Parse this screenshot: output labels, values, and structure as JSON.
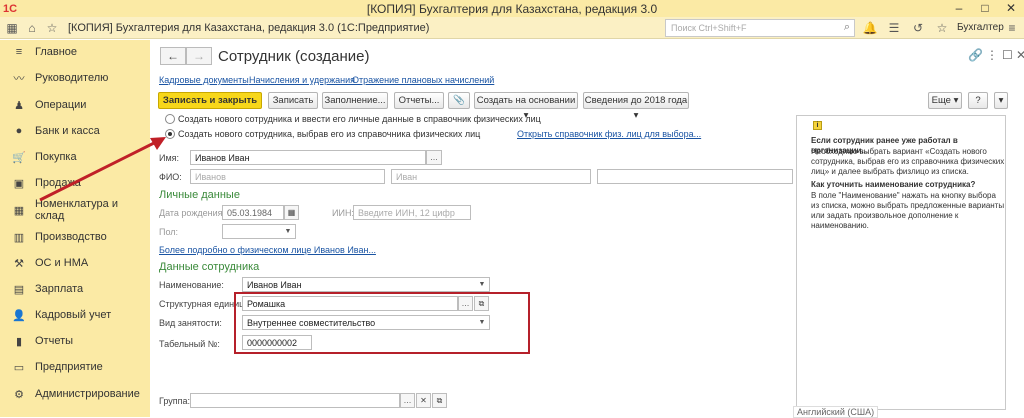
{
  "app": {
    "logo": "1С",
    "title": "[КОПИЯ] Бухгалтерия для Казахстана, редакция 3.0",
    "subtitle": "[КОПИЯ] Бухгалтерия для Казахстана, редакция 3.0  (1С:Предприятие)",
    "search_placeholder": "Поиск Ctrl+Shift+F",
    "user": "Бухгалтер"
  },
  "sidebar": {
    "items": [
      {
        "label": "Главное",
        "icon": "menu-icon"
      },
      {
        "label": "Руководителю",
        "icon": "chart-icon"
      },
      {
        "label": "Операции",
        "icon": "operations-icon"
      },
      {
        "label": "Банк и касса",
        "icon": "bank-icon"
      },
      {
        "label": "Покупка",
        "icon": "cart-icon"
      },
      {
        "label": "Продажа",
        "icon": "bag-icon"
      },
      {
        "label": "Номенклатура и склад",
        "icon": "warehouse-icon"
      },
      {
        "label": "Производство",
        "icon": "production-icon"
      },
      {
        "label": "ОС и НМА",
        "icon": "assets-icon"
      },
      {
        "label": "Зарплата",
        "icon": "salary-icon"
      },
      {
        "label": "Кадровый учет",
        "icon": "personnel-icon"
      },
      {
        "label": "Отчеты",
        "icon": "reports-icon"
      },
      {
        "label": "Предприятие",
        "icon": "enterprise-icon"
      },
      {
        "label": "Администрирование",
        "icon": "admin-icon"
      }
    ]
  },
  "form": {
    "title": "Сотрудник (создание)",
    "links": [
      "Кадровые документы",
      "Начисления и удержания",
      "Отражение плановых начислений"
    ],
    "buttons": {
      "save_close": "Записать и закрыть",
      "save": "Записать",
      "fill": "Заполнение...",
      "reports": "Отчеты...",
      "create_based": "Создать на основании",
      "info2018": "Сведения до 2018 года",
      "more": "Еще",
      "help": "?"
    },
    "radio1": "Создать нового сотрудника и ввести его личные данные в справочник физических лиц",
    "radio2": "Создать нового сотрудника, выбрав его из справочника физических лиц",
    "open_ref_link": "Открыть справочник физ. лиц для выбора...",
    "name_label": "Имя:",
    "name_value": "Иванов Иван",
    "fio_label": "ФИО:",
    "fio_placeholder1": "Иванов",
    "fio_placeholder2": "Иван",
    "personal_section": "Личные данные",
    "birth_label": "Дата рождения:",
    "birth_value": "05.03.1984",
    "iin_label": "ИИН:",
    "iin_placeholder": "Введите ИИН, 12 цифр",
    "sex_label": "Пол:",
    "more_link": "Более подробно о физическом лице Иванов Иван...",
    "employee_section": "Данные сотрудника",
    "naming_label": "Наименование:",
    "naming_value": "Иванов Иван",
    "unit_label": "Структурная единица:",
    "unit_value": "Ромашка",
    "employment_label": "Вид занятости:",
    "employment_value": "Внутреннее совместительство",
    "tabnum_label": "Табельный №:",
    "tabnum_value": "0000000002",
    "group_label": "Группа:"
  },
  "help": {
    "q1": "Если сотрудник ранее уже работал в организации...",
    "a1": "Необходимо выбрать вариант «Создать нового сотрудника, выбрав его из справочника физических лиц» и далее выбрать физлицо из списка.",
    "q2": "Как уточнить наименование сотрудника?",
    "a2": "В поле \"Наименование\" нажать на кнопку выбора из списка, можно выбрать предложенные варианты или задать произвольное дополнение к наименованию."
  },
  "statusbar": {
    "keyboard": "Английский (США)"
  },
  "colors": {
    "accent": "#f7d71a",
    "sidebar": "#fbeaa5",
    "highlight": "#b5202a",
    "link": "#1a54a3"
  }
}
